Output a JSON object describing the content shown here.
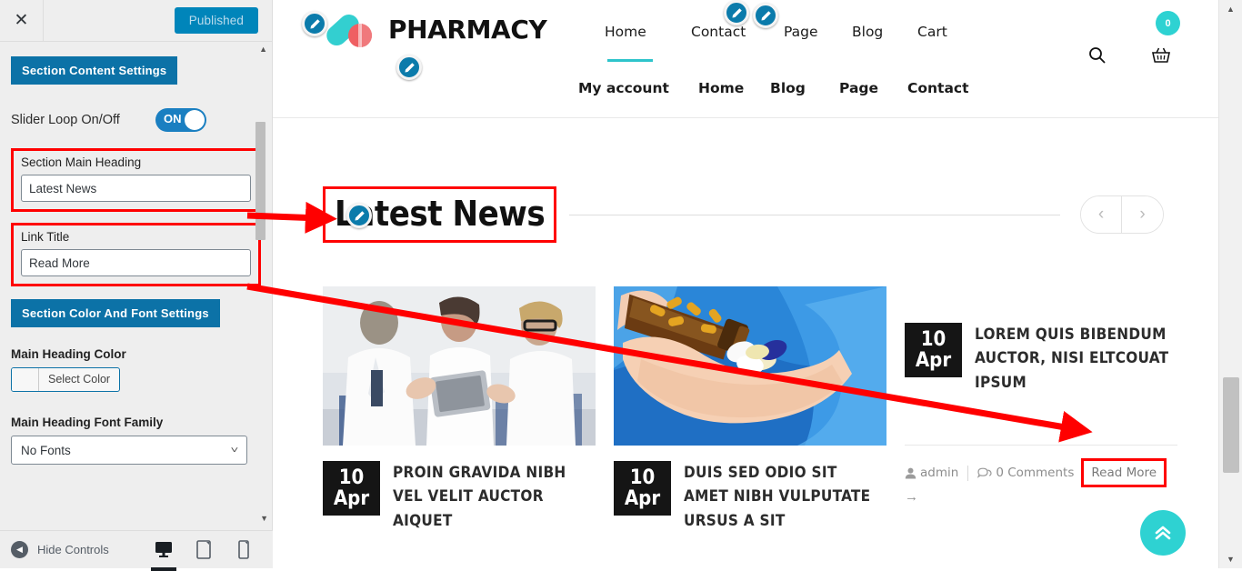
{
  "customizer": {
    "close_icon": "close-icon",
    "publish_label": "Published",
    "section_content_settings": "Section Content Settings",
    "slider_loop_label": "Slider Loop On/Off",
    "slider_loop_state": "ON",
    "section_main_heading_label": "Section Main Heading",
    "section_main_heading_value": "Latest News",
    "link_title_label": "Link Title",
    "link_title_value": "Read More",
    "section_color_font_settings": "Section Color And Font Settings",
    "main_heading_color_label": "Main Heading Color",
    "select_color_label": "Select Color",
    "main_heading_font_family_label": "Main Heading Font Family",
    "font_family_value": "No Fonts",
    "hide_controls_label": "Hide Controls",
    "devices": [
      "desktop-icon",
      "tablet-icon",
      "mobile-icon"
    ],
    "active_device": "desktop-icon",
    "accent_color": "#0c72a7",
    "highlight_color": "#ff0000"
  },
  "site": {
    "logo_text": "PHARMACY",
    "nav_primary": [
      "Home",
      "Contact",
      "Page",
      "Blog",
      "Cart"
    ],
    "nav_secondary": [
      "My account",
      "Home",
      "Blog",
      "Page",
      "Contact"
    ],
    "active_nav": "Home",
    "search_icon": "search-icon",
    "cart_icon": "basket-icon",
    "cart_count": "0",
    "accent_teal": "#2ec4cb"
  },
  "section": {
    "heading": "Latest News",
    "prev_label": "‹",
    "next_label": "›"
  },
  "articles": [
    {
      "image": "doctors-with-tablet-photo",
      "day": "10",
      "month": "Apr",
      "title": "PROIN GRAVIDA NIBH VEL VELIT AUCTOR AIQUET"
    },
    {
      "image": "pills-in-hand-photo",
      "day": "10",
      "month": "Apr",
      "title": "DUIS SED ODIO SIT AMET NIBH VULPUTATE URSUS A SIT"
    },
    {
      "day": "10",
      "month": "Apr",
      "title": "LOREM QUIS BIBENDUM AUCTOR, NISI ELTCOUAT IPSUM",
      "author": "admin",
      "comments": "0 Comments",
      "read_more": "Read More"
    }
  ],
  "to_top": {
    "icon": "double-chevron-up-icon"
  }
}
